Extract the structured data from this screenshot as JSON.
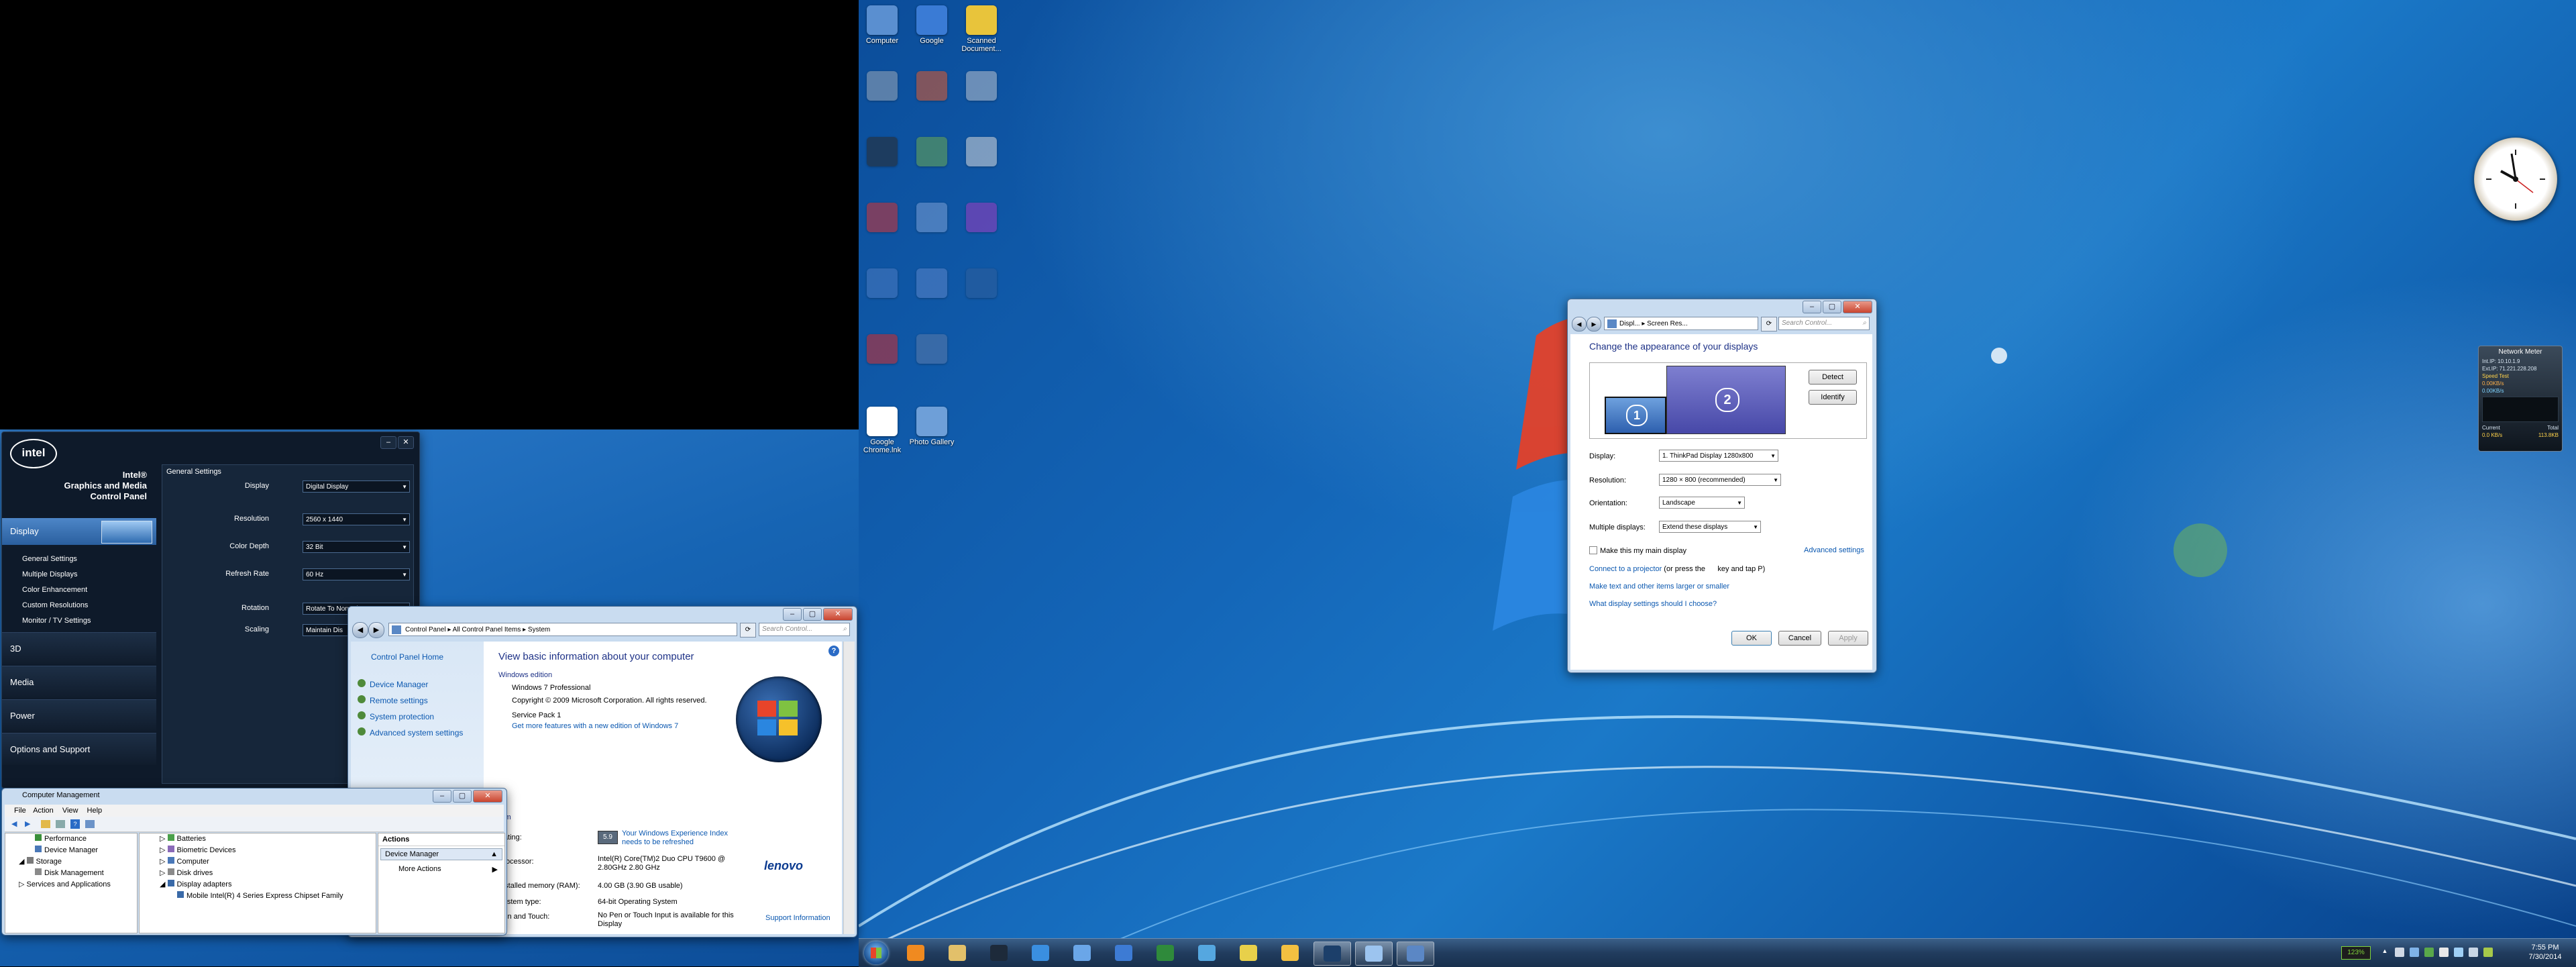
{
  "desktop": {
    "icons": [
      {
        "label": "Computer",
        "color": "#5a8fd0"
      },
      {
        "label": "Google",
        "color": "#3a7bd5"
      },
      {
        "label": "Scanned Document...",
        "color": "#e8c43b"
      },
      {
        "label": "",
        "color": "#9aa7b5"
      },
      {
        "label": "",
        "color": "#e05a2a"
      },
      {
        "label": "",
        "color": "#b8c0cc"
      },
      {
        "label": "",
        "color": "#2b2b2b"
      },
      {
        "label": "",
        "color": "#6aa84f"
      },
      {
        "label": "",
        "color": "#d8d8d8"
      },
      {
        "label": "",
        "color": "#d23131"
      },
      {
        "label": "",
        "color": "#7a9ed4"
      },
      {
        "label": "",
        "color": "#9c3cc0"
      },
      {
        "label": "",
        "color": "#4a7ac0"
      },
      {
        "label": "",
        "color": "#5a84c8"
      },
      {
        "label": "",
        "color": "#2f5f9c"
      },
      {
        "label": "",
        "color": "#d02a2a"
      },
      {
        "label": "",
        "color": "#5b79a8"
      },
      {
        "label": "Google Chrome.lnk",
        "color": "#ffffff"
      },
      {
        "label": "Photo Gallery",
        "color": "#6e9fd8"
      }
    ]
  },
  "intel": {
    "logo": "intel",
    "title_lines": [
      "Intel®",
      "Graphics and Media",
      "Control Panel"
    ],
    "nav": {
      "display": "Display",
      "sub": [
        "General Settings",
        "Multiple Displays",
        "Color Enhancement",
        "Custom Resolutions",
        "Monitor / TV Settings"
      ],
      "d3": "3D",
      "media": "Media",
      "power": "Power",
      "options": "Options and Support"
    },
    "section_title": "General Settings",
    "rows": [
      {
        "label": "Display",
        "value": "Digital Display"
      },
      {
        "label": "Resolution",
        "value": "2560 x 1440"
      },
      {
        "label": "Color Depth",
        "value": "32 Bit"
      },
      {
        "label": "Refresh Rate",
        "value": "60 Hz"
      },
      {
        "label": "Rotation",
        "value": "Rotate To Normal"
      },
      {
        "label": "Scaling",
        "value": "Maintain Dis"
      }
    ]
  },
  "system": {
    "address": [
      "Control Panel",
      "All Control Panel Items",
      "System"
    ],
    "search_placeholder": "Search Control...",
    "sidebar": {
      "home": "Control Panel Home",
      "links": [
        "Device Manager",
        "Remote settings",
        "System protection",
        "Advanced system settings"
      ]
    },
    "heading": "View basic information about your computer",
    "edition_label": "Windows edition",
    "edition": "Windows 7 Professional",
    "copyright": "Copyright © 2009 Microsoft Corporation.  All rights reserved.",
    "service_pack": "Service Pack 1",
    "more_features": "Get more features with a new edition of Windows 7",
    "system_label": "System",
    "rating_label": "Rating:",
    "rating_badge": "5.9",
    "rating_link": "Your Windows Experience Index needs to be refreshed",
    "processor_label": "Processor:",
    "processor_value": "Intel(R) Core(TM)2 Duo CPU     T9600  @ 2.80GHz   2.80 GHz",
    "ram_label": "Installed memory (RAM):",
    "ram_value": "4.00 GB (3.90 GB usable)",
    "type_label": "System type:",
    "type_value": "64-bit Operating System",
    "pen_label": "Pen and Touch:",
    "pen_value": "No Pen or Touch Input is available for this Display",
    "brand": "lenovo",
    "support_link": "Support Information"
  },
  "compmgmt": {
    "title": "Computer Management",
    "menu": [
      "File",
      "Action",
      "View",
      "Help"
    ],
    "tree": [
      "Performance",
      "Device Manager",
      "Storage",
      "Disk Management",
      "Services and Applications"
    ],
    "devices": [
      "Batteries",
      "Biometric Devices",
      "Computer",
      "Disk drives",
      "Display adapters",
      "Mobile Intel(R) 4 Series Express Chipset Family"
    ],
    "actions_header": "Actions",
    "actions_selected": "Device Manager",
    "more_actions": "More Actions"
  },
  "screenres": {
    "address": [
      "Displ...",
      "Screen Res..."
    ],
    "search_placeholder": "Search Control...",
    "heading": "Change the appearance of your displays",
    "monitor1": "1",
    "monitor2": "2",
    "detect": "Detect",
    "identify": "Identify",
    "display_label": "Display:",
    "display_value": "1. ThinkPad Display 1280x800",
    "resolution_label": "Resolution:",
    "resolution_value": "1280 × 800 (recommended)",
    "orientation_label": "Orientation:",
    "orientation_value": "Landscape",
    "multiple_label": "Multiple displays:",
    "multiple_value": "Extend these displays",
    "main_display": "Make this my main display",
    "advanced": "Advanced settings",
    "projector_link": "Connect to a projector",
    "projector_rest": "(or press the      key and tap P)",
    "text_link": "Make text and other items larger or smaller",
    "choose_link": "What display settings should I choose?",
    "ok": "OK",
    "cancel": "Cancel",
    "apply": "Apply"
  },
  "gadget": {
    "title": "Network Meter",
    "lines": [
      "Int.IP: 10.10.1.9",
      "Ext.IP: 71.221.228.208",
      "Speed Test",
      "0.00KB/s",
      "0.00KB/s",
      "Current",
      "Total",
      "0.0 KB/s",
      "113.8KB"
    ]
  },
  "taskbar": {
    "time": "7:55 PM",
    "date": "7/30/2014",
    "battery": "123%",
    "items": [
      {
        "name": "media-player",
        "color": "#f08a20"
      },
      {
        "name": "explorer",
        "color": "#e2c06a"
      },
      {
        "name": "app-bird",
        "color": "#1d2a3a"
      },
      {
        "name": "internet-explorer",
        "color": "#3a8fe0"
      },
      {
        "name": "people",
        "color": "#6aa6e8"
      },
      {
        "name": "calendar",
        "color": "#3d7bd4"
      },
      {
        "name": "spreadsheet",
        "color": "#2f8a3b"
      },
      {
        "name": "globe",
        "color": "#55a7e0"
      },
      {
        "name": "chrome",
        "color": "#e8d04a"
      },
      {
        "name": "folder",
        "color": "#f2c041"
      },
      {
        "name": "graphics-panel",
        "color": "#1c3f6a"
      },
      {
        "name": "display-settings",
        "color": "#9cc4ef"
      },
      {
        "name": "computer-management",
        "color": "#5b87c5"
      }
    ]
  }
}
